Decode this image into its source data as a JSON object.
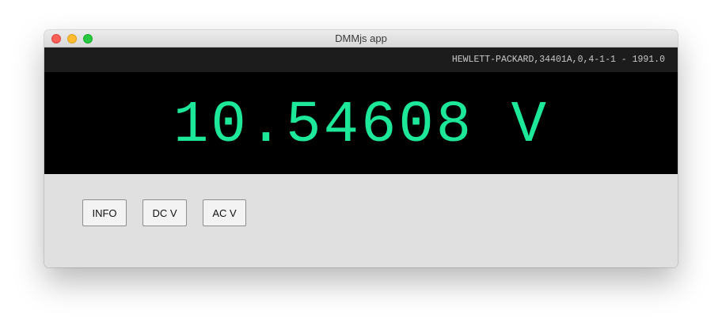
{
  "window": {
    "title": "DMMjs app"
  },
  "instrument": {
    "id_string": "HEWLETT-PACKARD,34401A,0,4-1-1 - 1991.0"
  },
  "display": {
    "reading": "10.54608 V",
    "color": "#1de89a"
  },
  "controls": {
    "buttons": [
      {
        "label": "INFO"
      },
      {
        "label": "DC V"
      },
      {
        "label": "AC V"
      }
    ]
  }
}
